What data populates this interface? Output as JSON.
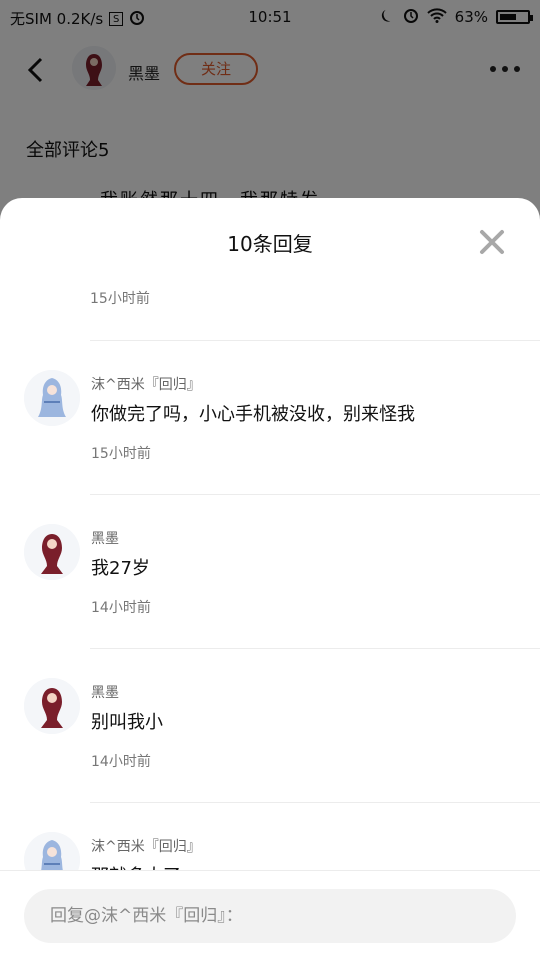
{
  "status_bar": {
    "carrier": "无SIM 0.2K/s",
    "s_badge": "S",
    "time": "10:51",
    "battery_percent": "63%",
    "battery_level": 0.63,
    "icons": [
      "alarm-icon",
      "moon-icon",
      "wifi-icon",
      "battery-icon"
    ]
  },
  "topbar": {
    "author_name": "黑墨",
    "follow_label": "关注"
  },
  "comments_header": "全部评论5",
  "peek_text": "我账然那十四…我那特发",
  "sheet": {
    "title": "10条回复",
    "first_time": "15小时前",
    "replies": [
      {
        "name": "沫^西米『回归』",
        "text": "你做完了吗，小心手机被没收，别来怪我",
        "time": "15小时前",
        "avatar": "anime-avatar-blue"
      },
      {
        "name": "黑墨",
        "text": "我27岁",
        "time": "14小时前",
        "avatar": "anime-avatar-red"
      },
      {
        "name": "黑墨",
        "text": "别叫我小",
        "time": "14小时前",
        "avatar": "anime-avatar-red"
      },
      {
        "name": "沫^西米『回归』",
        "text": "那就多大了",
        "time": "",
        "avatar": "anime-avatar-blue"
      }
    ],
    "reply_placeholder": "回复@沫^西米『回归』："
  },
  "colors": {
    "accent": "#e05a2b",
    "overlay": "rgba(0,0,0,0.5)",
    "divider": "#ececec",
    "input_bg": "#f2f2f2"
  }
}
